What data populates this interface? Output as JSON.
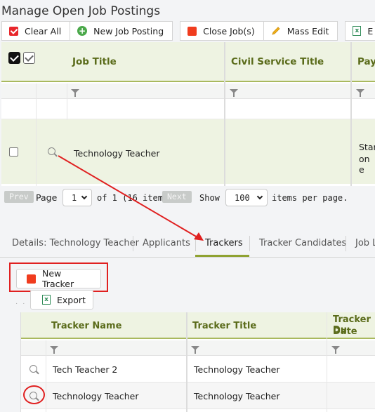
{
  "page": {
    "title": "Manage Open Job Postings"
  },
  "toolbar": {
    "clear_all": "Clear All",
    "new_job_posting": "New Job Posting",
    "close_jobs": "Close Job(s)",
    "mass_edit": "Mass Edit",
    "export_partial": "E"
  },
  "grid": {
    "columns": [
      "Job Title",
      "Civil Service Title",
      "Pay"
    ],
    "row": {
      "job_title": "Technology Teacher",
      "pay_line1": "Star",
      "pay_line2": "on e"
    }
  },
  "pager": {
    "prev": "Prev",
    "page_label": "Page",
    "page_value": "1",
    "of_text": "of 1 (16 items)",
    "next": "Next",
    "show_label": "Show",
    "page_size": "100",
    "items_per_page": "items per page."
  },
  "tabs": [
    "Details: Technology Teacher",
    "Applicants",
    "Trackers",
    "Tracker Candidates",
    "Job L"
  ],
  "active_tab": "Trackers",
  "tracker_toolbar": {
    "new_tracker": "New Tracker",
    "export": "Export"
  },
  "tracker_grid": {
    "columns": [
      "Tracker Name",
      "Tracker Title",
      "Tracker Du",
      "Date"
    ],
    "rows": [
      {
        "name": "Tech Teacher 2",
        "title": "Technology Teacher"
      },
      {
        "name": "Technology Teacher",
        "title": "Technology Teacher"
      }
    ]
  },
  "annotation_color": "#e02020",
  "accent_color": "#8fa231"
}
